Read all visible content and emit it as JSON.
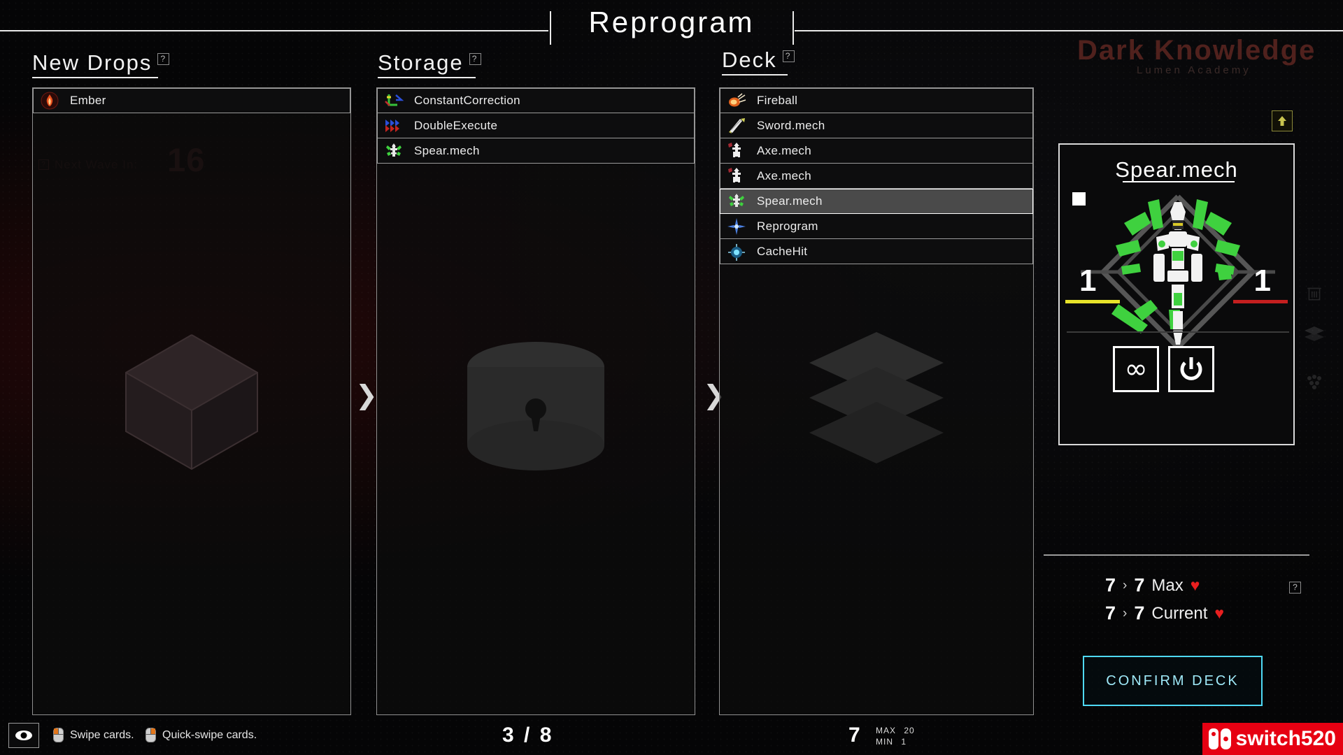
{
  "window": {
    "title": "Reprogram"
  },
  "columns": {
    "new_drops": {
      "header": "New Drops",
      "help": "?",
      "items": [
        {
          "name": "Ember",
          "icon": "ember-icon"
        }
      ],
      "placeholder_icon": "cube-icon"
    },
    "storage": {
      "header": "Storage",
      "help": "?",
      "items": [
        {
          "name": "ConstantCorrection",
          "icon": "constant-correction-icon"
        },
        {
          "name": "DoubleExecute",
          "icon": "double-execute-icon"
        },
        {
          "name": "Spear.mech",
          "icon": "spear-mech-icon"
        }
      ],
      "placeholder_icon": "vault-icon",
      "counter": "3 / 8"
    },
    "deck": {
      "header": "Deck",
      "help": "?",
      "items": [
        {
          "name": "Fireball",
          "icon": "fireball-icon",
          "selected": false
        },
        {
          "name": "Sword.mech",
          "icon": "sword-mech-icon",
          "selected": false
        },
        {
          "name": "Axe.mech",
          "icon": "axe-mech-icon",
          "selected": false
        },
        {
          "name": "Axe.mech",
          "icon": "axe-mech-icon",
          "selected": false
        },
        {
          "name": "Spear.mech",
          "icon": "spear-mech-icon",
          "selected": true
        },
        {
          "name": "Reprogram",
          "icon": "reprogram-icon",
          "selected": false
        },
        {
          "name": "CacheHit",
          "icon": "cache-hit-icon",
          "selected": false
        }
      ],
      "placeholder_icon": "deck-stack-icon",
      "counter": "7",
      "max_label": "MAX",
      "max_value": "20",
      "min_label": "MIN",
      "min_value": "1"
    }
  },
  "detail": {
    "title": "Spear.mech",
    "chip": "rarity-chip",
    "art": "spear-mech-art",
    "left_stat": "1",
    "right_stat": "1",
    "left_bar_color": "#e8e32a",
    "right_bar_color": "#c41f1f",
    "icons": [
      {
        "name": "infinity-icon",
        "glyph": "∞"
      },
      {
        "name": "power-icon",
        "glyph": "power"
      }
    ]
  },
  "hp": {
    "max": {
      "from": "7",
      "chev": "›",
      "to": "7",
      "label": "Max",
      "heart": "♥"
    },
    "current": {
      "from": "7",
      "chev": "›",
      "to": "7",
      "label": "Current",
      "heart": "♥"
    },
    "help": "?"
  },
  "confirm": {
    "label": "CONFIRM DECK",
    "color": "#4fd9f5"
  },
  "bottom": {
    "eye": "eye-icon",
    "hints": [
      {
        "icon": "mouse-left-icon",
        "text": "Swipe cards."
      },
      {
        "icon": "mouse-right-icon",
        "text": "Quick-swipe cards."
      }
    ],
    "watermark": "switch520"
  },
  "background": {
    "game_title": "Dark Knowledge",
    "game_subtitle": "Lumen Academy",
    "wave_help": "?",
    "wave_label": "Next Wave In:",
    "wave_value": "16"
  }
}
